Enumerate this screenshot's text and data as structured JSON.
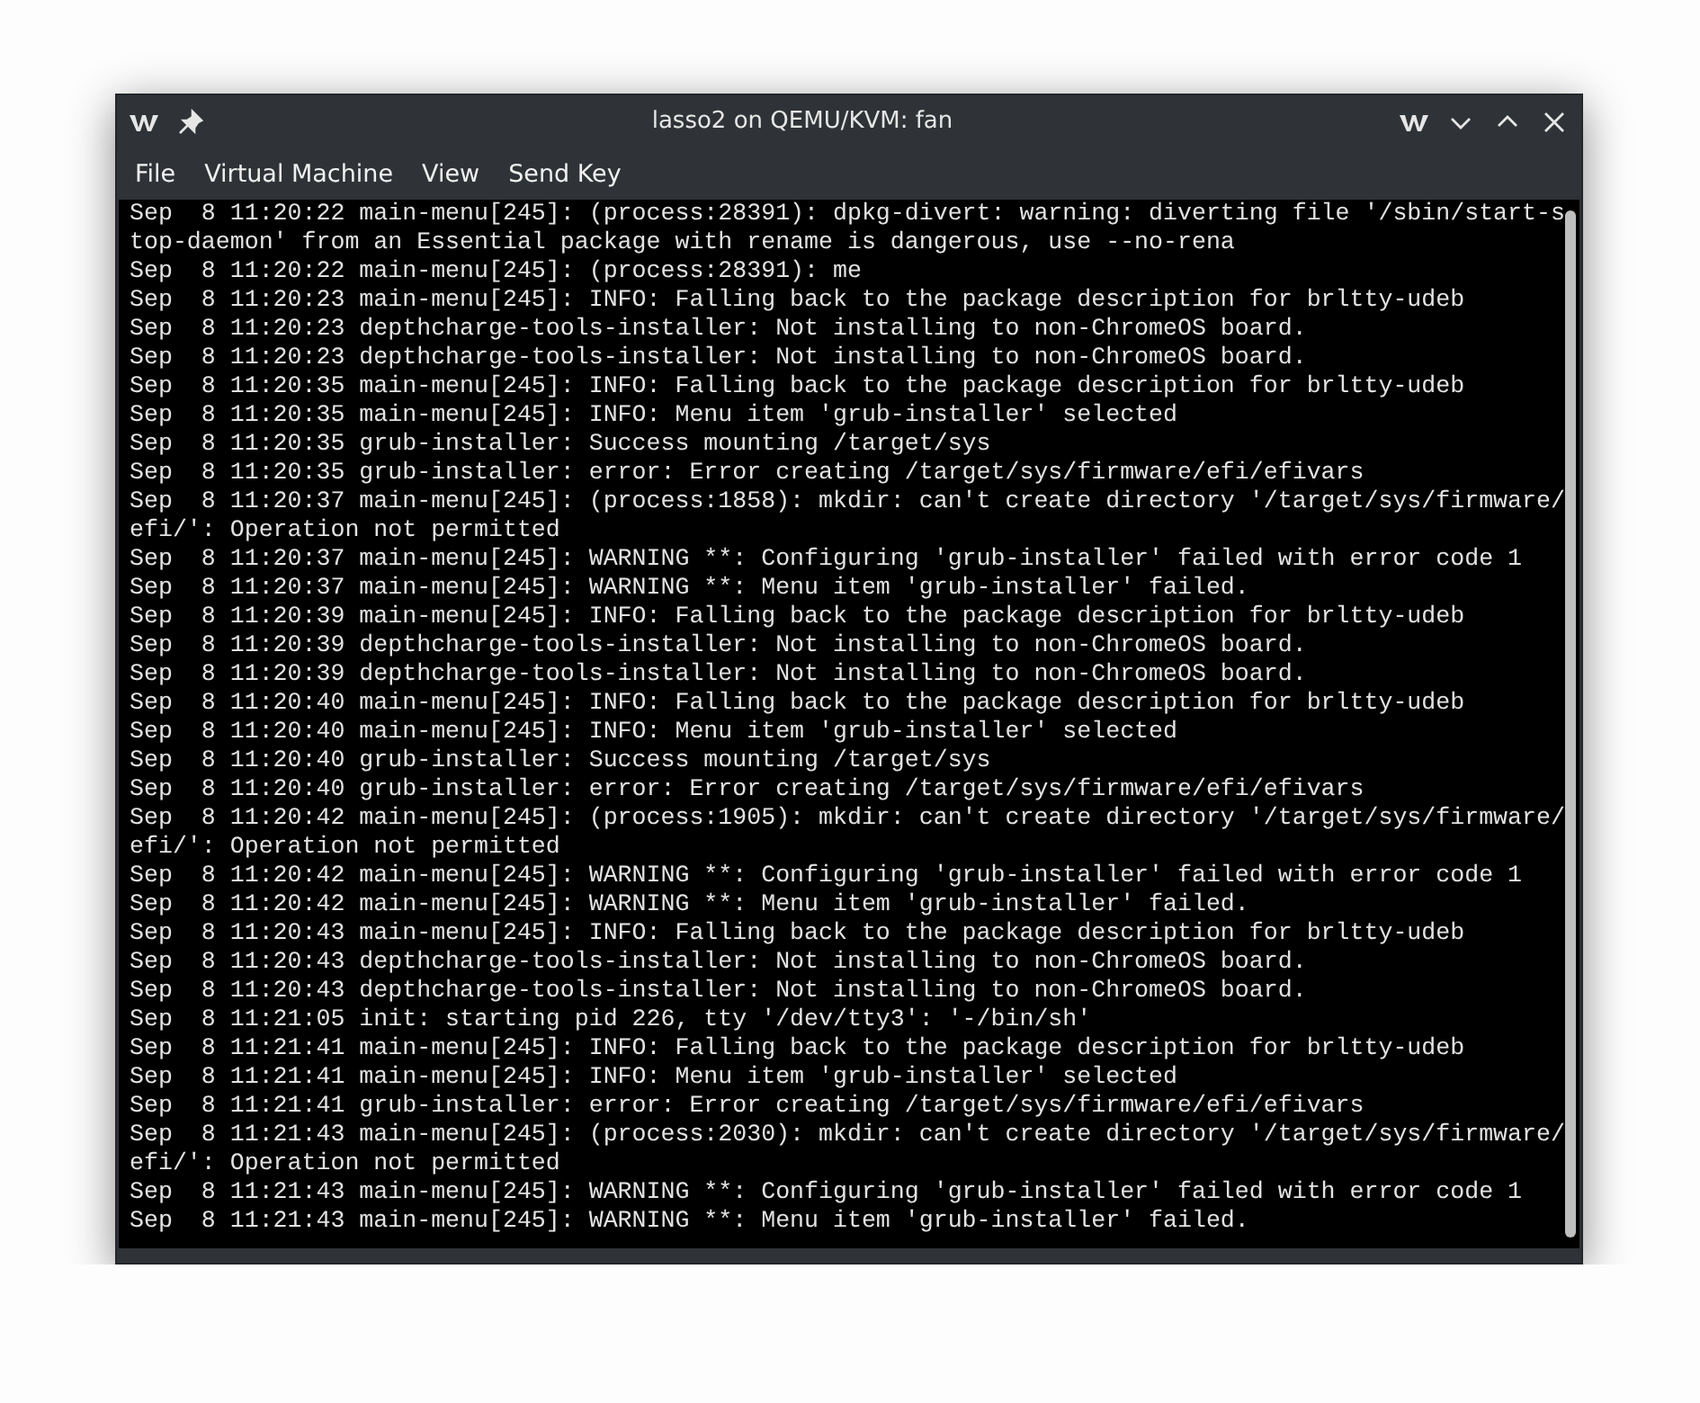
{
  "window": {
    "title": "lasso2 on QEMU/KVM: fan"
  },
  "menu": [
    "File",
    "Virtual Machine",
    "View",
    "Send Key"
  ],
  "console": {
    "lines": [
      "Sep  8 11:20:22 main-menu[245]: (process:28391): dpkg-divert: warning: diverting file '/sbin/start-s",
      "top-daemon' from an Essential package with rename is dangerous, use --no-rena",
      "Sep  8 11:20:22 main-menu[245]: (process:28391): me",
      "Sep  8 11:20:23 main-menu[245]: INFO: Falling back to the package description for brltty-udeb",
      "Sep  8 11:20:23 depthcharge-tools-installer: Not installing to non-ChromeOS board.",
      "Sep  8 11:20:23 depthcharge-tools-installer: Not installing to non-ChromeOS board.",
      "Sep  8 11:20:35 main-menu[245]: INFO: Falling back to the package description for brltty-udeb",
      "Sep  8 11:20:35 main-menu[245]: INFO: Menu item 'grub-installer' selected",
      "Sep  8 11:20:35 grub-installer: Success mounting /target/sys",
      "Sep  8 11:20:35 grub-installer: error: Error creating /target/sys/firmware/efi/efivars",
      "Sep  8 11:20:37 main-menu[245]: (process:1858): mkdir: can't create directory '/target/sys/firmware/",
      "efi/': Operation not permitted",
      "Sep  8 11:20:37 main-menu[245]: WARNING **: Configuring 'grub-installer' failed with error code 1",
      "Sep  8 11:20:37 main-menu[245]: WARNING **: Menu item 'grub-installer' failed.",
      "Sep  8 11:20:39 main-menu[245]: INFO: Falling back to the package description for brltty-udeb",
      "Sep  8 11:20:39 depthcharge-tools-installer: Not installing to non-ChromeOS board.",
      "Sep  8 11:20:39 depthcharge-tools-installer: Not installing to non-ChromeOS board.",
      "Sep  8 11:20:40 main-menu[245]: INFO: Falling back to the package description for brltty-udeb",
      "Sep  8 11:20:40 main-menu[245]: INFO: Menu item 'grub-installer' selected",
      "Sep  8 11:20:40 grub-installer: Success mounting /target/sys",
      "Sep  8 11:20:40 grub-installer: error: Error creating /target/sys/firmware/efi/efivars",
      "Sep  8 11:20:42 main-menu[245]: (process:1905): mkdir: can't create directory '/target/sys/firmware/",
      "efi/': Operation not permitted",
      "Sep  8 11:20:42 main-menu[245]: WARNING **: Configuring 'grub-installer' failed with error code 1",
      "Sep  8 11:20:42 main-menu[245]: WARNING **: Menu item 'grub-installer' failed.",
      "Sep  8 11:20:43 main-menu[245]: INFO: Falling back to the package description for brltty-udeb",
      "Sep  8 11:20:43 depthcharge-tools-installer: Not installing to non-ChromeOS board.",
      "Sep  8 11:20:43 depthcharge-tools-installer: Not installing to non-ChromeOS board.",
      "Sep  8 11:21:05 init: starting pid 226, tty '/dev/tty3': '-/bin/sh'",
      "Sep  8 11:21:41 main-menu[245]: INFO: Falling back to the package description for brltty-udeb",
      "Sep  8 11:21:41 main-menu[245]: INFO: Menu item 'grub-installer' selected",
      "Sep  8 11:21:41 grub-installer: error: Error creating /target/sys/firmware/efi/efivars",
      "Sep  8 11:21:43 main-menu[245]: (process:2030): mkdir: can't create directory '/target/sys/firmware/",
      "efi/': Operation not permitted",
      "Sep  8 11:21:43 main-menu[245]: WARNING **: Configuring 'grub-installer' failed with error code 1",
      "Sep  8 11:21:43 main-menu[245]: WARNING **: Menu item 'grub-installer' failed."
    ]
  }
}
